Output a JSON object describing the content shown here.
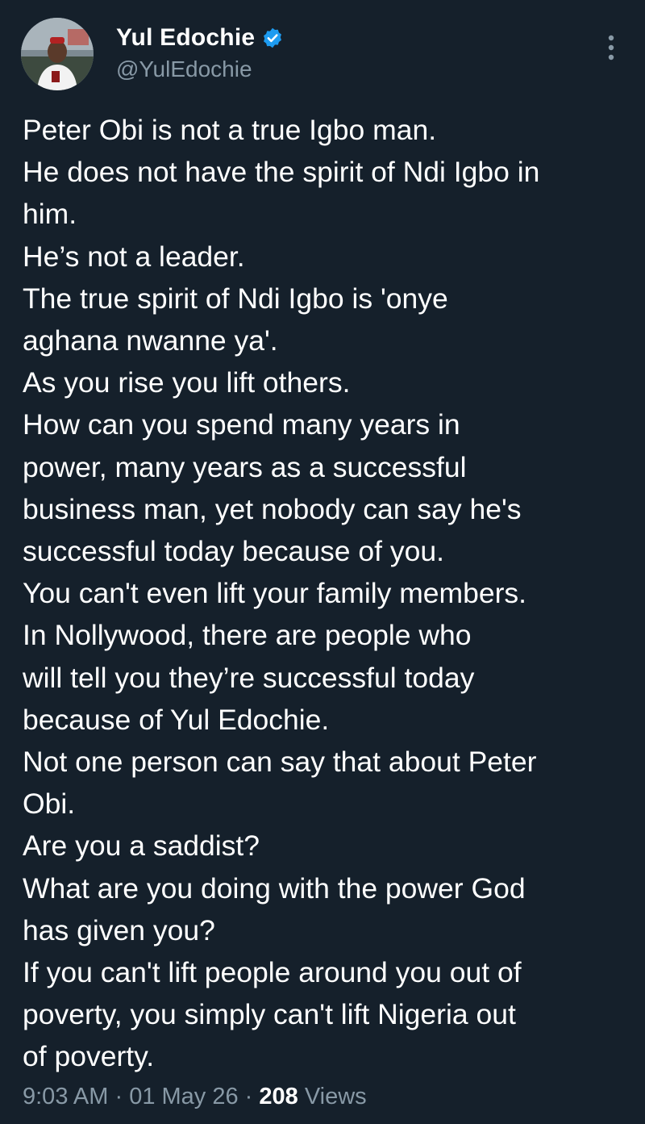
{
  "author": {
    "display_name": "Yul Edochie",
    "handle": "@YulEdochie",
    "verified": true,
    "verified_color": "#1d9bf0"
  },
  "tweet": {
    "lines": [
      "Peter Obi is not a true Igbo man.",
      "He does not have the spirit of Ndi Igbo in",
      "him.",
      "He’s not a leader.",
      "The true spirit of Ndi Igbo is 'onye",
      "aghana nwanne ya'.",
      "As you rise you lift others.",
      "How can you spend many years in",
      "power, many years as a successful",
      "business man, yet nobody can say he's",
      "successful today because of you.",
      "You can't even lift your family members.",
      "In Nollywood, there are people who",
      "will tell you they’re successful today",
      "because of Yul Edochie.",
      "Not one person can say that about Peter",
      "Obi.",
      "Are you a saddist?",
      "What are you doing with the power God",
      "has given you?",
      "If you can't lift people around you out of",
      "poverty, you simply can't lift Nigeria out",
      "of poverty."
    ]
  },
  "meta": {
    "time": "9:03 AM",
    "separator1": " · ",
    "date": "01 May 26",
    "separator2": " · ",
    "views_count": "208",
    "views_label": " Views"
  },
  "colors": {
    "background": "#15202b",
    "text": "#ffffff",
    "secondary_text": "#8899a6"
  },
  "icons": {
    "verified": "verified-badge-icon",
    "more": "more-vertical-icon"
  }
}
